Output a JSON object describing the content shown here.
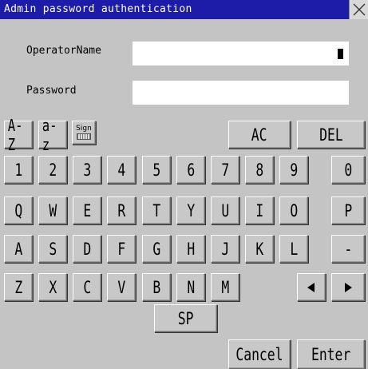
{
  "window": {
    "title": "Admin password authentication"
  },
  "form": {
    "operator_label": "OperatorName",
    "password_label": "Password",
    "operator_value": "",
    "password_value": ""
  },
  "keys": {
    "upper": "A-Z",
    "lower": "a-z",
    "sign": "Sign",
    "ac": "AC",
    "del": "DEL",
    "sp": "SP",
    "cancel": "Cancel",
    "enter": "Enter",
    "row_numbers": [
      "1",
      "2",
      "3",
      "4",
      "5",
      "6",
      "7",
      "8",
      "9",
      "0"
    ],
    "row_q": [
      "Q",
      "W",
      "E",
      "R",
      "T",
      "Y",
      "U",
      "I",
      "O",
      "P"
    ],
    "row_a": [
      "A",
      "S",
      "D",
      "F",
      "G",
      "H",
      "J",
      "K",
      "L",
      "-"
    ],
    "row_z": [
      "Z",
      "X",
      "C",
      "V",
      "B",
      "N",
      "M"
    ]
  },
  "icons": {
    "close": "close-icon",
    "left": "left-arrow-icon",
    "right": "right-arrow-icon",
    "sign_keyboard": "keyboard-icon"
  },
  "colors": {
    "titlebar": "#1c1ca8",
    "background": "#c4c4c4",
    "key": "#c8c8c8",
    "field": "#ffffff"
  }
}
